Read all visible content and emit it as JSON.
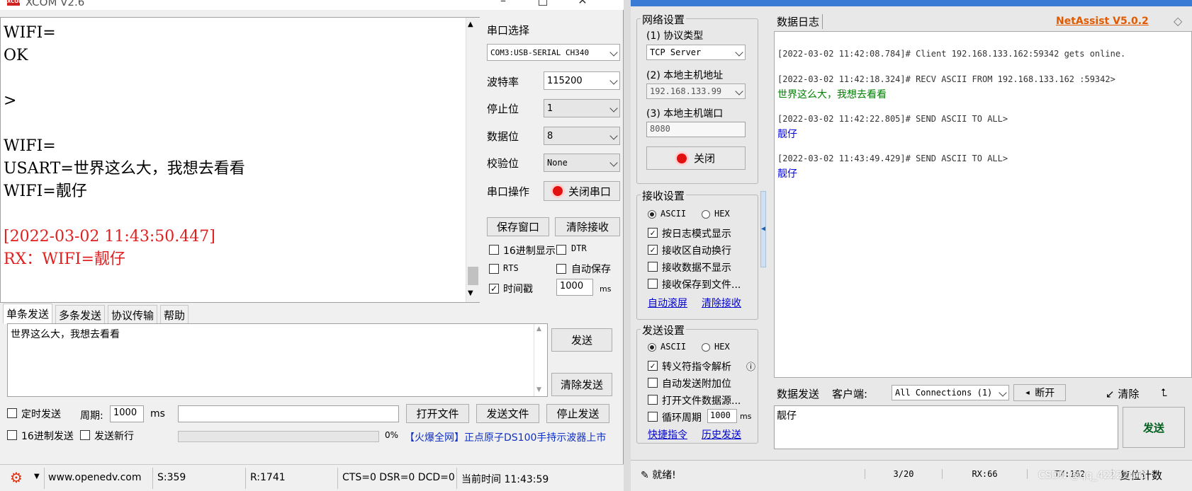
{
  "xcom": {
    "title": "XCOM V2.6",
    "logo": "XCOM",
    "recv_lines": [
      {
        "text": "WIFI=",
        "color": "#000000"
      },
      {
        "text": "OK",
        "color": "#000000"
      },
      {
        "text": "",
        "color": "#000000"
      },
      {
        "text": ">",
        "color": "#000000"
      },
      {
        "text": "",
        "color": "#000000"
      },
      {
        "text": "WIFI=",
        "color": "#000000"
      },
      {
        "text": "USART=世界这么大，我想去看看",
        "color": "#000000"
      },
      {
        "text": "WIFI=靓仔",
        "color": "#000000"
      },
      {
        "text": "",
        "color": "#000000"
      },
      {
        "text": "[2022-03-02 11:43:50.447]",
        "color": "#e02020"
      },
      {
        "text": "RX：WIFI=靓仔",
        "color": "#e02020"
      }
    ],
    "serial_select_label": "串口选择",
    "serial_port": "COM3:USB-SERIAL CH340",
    "baud_label": "波特率",
    "baud": "115200",
    "stop_label": "停止位",
    "stop": "1",
    "data_label": "数据位",
    "data": "8",
    "parity_label": "校验位",
    "parity": "None",
    "op_label": "串口操作",
    "close_port": "关闭串口",
    "save_window": "保存窗口",
    "clear_recv": "清除接收",
    "hex_display": "16进制显示",
    "dtr": "DTR",
    "rts": "RTS",
    "auto_save": "自动保存",
    "timestamp": "时间戳",
    "ts_value": "1000",
    "ms": "ms",
    "tabs": [
      "单条发送",
      "多条发送",
      "协议传输",
      "帮助"
    ],
    "send_text": "世界这么大，我想去看看",
    "send": "发送",
    "clear_send": "清除发送",
    "timed_send": "定时发送",
    "period_label": "周期:",
    "period": "1000",
    "period_ms": "ms",
    "open_file": "打开文件",
    "send_file": "发送文件",
    "stop_send": "停止发送",
    "hex_send": "16进制发送",
    "send_newline": "发送新行",
    "progress": "0%",
    "ad": "【火爆全网】正点原子DS100手持示波器上市",
    "status": {
      "site": "www.openedv.com",
      "s": "S:359",
      "r": "R:1741",
      "lines": "CTS=0 DSR=0 DCD=0",
      "time": "当前时间 11:43:59"
    }
  },
  "netassist": {
    "net_settings": "网络设置",
    "proto_label": "(1) 协议类型",
    "proto": "TCP Server",
    "host_label": "(2) 本地主机地址",
    "host": "192.168.133.99",
    "port_label": "(3) 本地主机端口",
    "port": "8080",
    "close": "关闭",
    "recv_settings": "接收设置",
    "ascii": "ASCII",
    "hex": "HEX",
    "log_mode": "按日志模式显示",
    "auto_wrap": "接收区自动换行",
    "no_show": "接收数据不显示",
    "save_file": "接收保存到文件...",
    "auto_scroll": "自动滚屏",
    "clear_recv": "清除接收",
    "send_settings": "发送设置",
    "escape": "转义符指令解析",
    "auto_checksum": "自动发送附加位",
    "open_file_src": "打开文件数据源...",
    "loop": "循环周期",
    "loop_val": "1000",
    "loop_ms": "ms",
    "shortcut": "快捷指令",
    "history": "历史发送",
    "log_tab": "数据日志",
    "brand": "NetAssist V5.0.2",
    "log": [
      {
        "head": "[2022-03-02 11:42:08.784]# Client 192.168.133.162:59342 gets online.",
        "body": "",
        "color": "#000000"
      },
      {
        "head": "[2022-03-02 11:42:18.324]# RECV ASCII FROM 192.168.133.162 :59342>",
        "body": "世界这么大，我想去看看",
        "color": "#008000"
      },
      {
        "head": "[2022-03-02 11:42:22.805]# SEND ASCII TO ALL>",
        "body": "靓仔",
        "color": "#0000dd"
      },
      {
        "head": "[2022-03-02 11:43:49.429]# SEND ASCII TO ALL>",
        "body": "靓仔",
        "color": "#0000dd"
      }
    ],
    "send_tab": "数据发送",
    "client_label": "客户端:",
    "client": "All Connections (1)",
    "disconnect": "断开",
    "clear": "清除",
    "send_text": "靓仔",
    "send": "发送",
    "status": {
      "ready": "就绪!",
      "count": "3/20",
      "rx": "RX:66",
      "tx": "TX:162",
      "reset": "复位计数"
    }
  },
  "watermark": "CSDN @qq_42222143"
}
